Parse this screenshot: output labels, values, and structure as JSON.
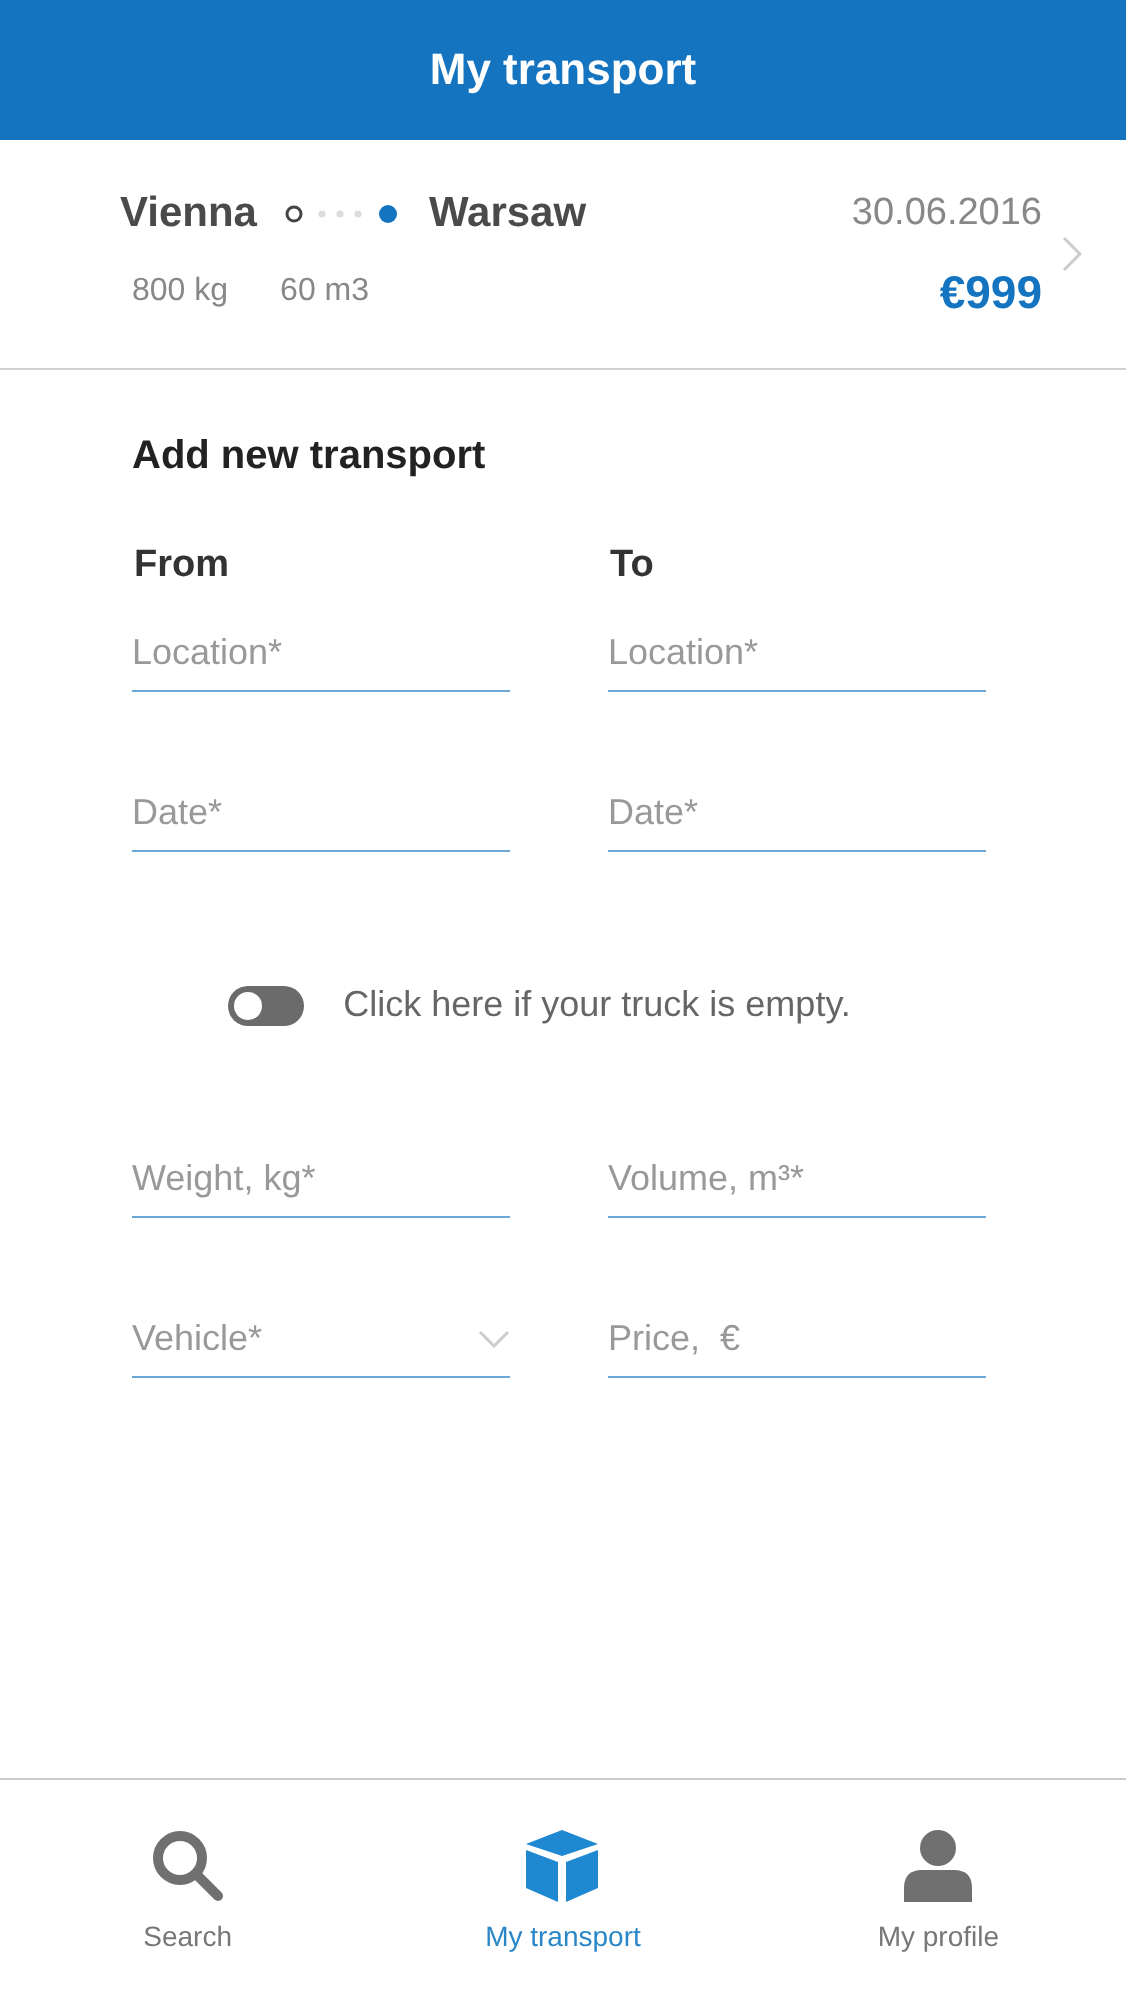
{
  "header": {
    "title": "My transport"
  },
  "transport": {
    "from": "Vienna",
    "to": "Warsaw",
    "date": "30.06.2016",
    "weight": "800 kg",
    "volume": "60 m3",
    "price": "€999"
  },
  "form": {
    "title": "Add new transport",
    "columns": [
      {
        "label": "From"
      },
      {
        "label": "To"
      }
    ],
    "rows": [
      [
        {
          "kind": "text",
          "placeholder": "Location*"
        },
        {
          "kind": "text",
          "placeholder": "Location*"
        }
      ],
      [
        {
          "kind": "text",
          "placeholder": "Date*"
        },
        {
          "kind": "text",
          "placeholder": "Date*"
        }
      ]
    ],
    "empty_truck": {
      "label": "Click here if your truck is empty.",
      "on": false
    },
    "cargo_rows": [
      [
        {
          "kind": "text",
          "placeholder": "Weight, kg*"
        },
        {
          "kind": "text",
          "placeholder": "Volume, m³*"
        }
      ],
      [
        {
          "kind": "select",
          "placeholder": "Vehicle*"
        },
        {
          "kind": "text",
          "placeholder": "Price,  €"
        }
      ]
    ]
  },
  "tabs": [
    {
      "label": "Search",
      "kind": "search",
      "selected": false
    },
    {
      "label": "My transport",
      "kind": "box",
      "selected": true
    },
    {
      "label": "My profile",
      "kind": "user",
      "selected": false
    }
  ]
}
